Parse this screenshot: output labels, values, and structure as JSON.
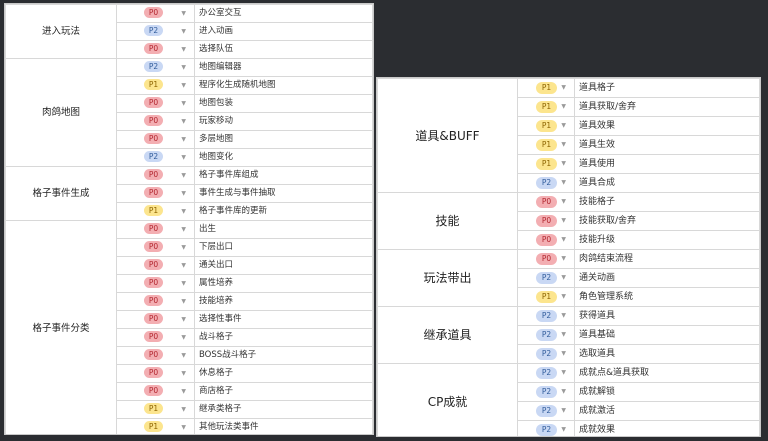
{
  "left_table": {
    "groups": [
      {
        "category": "进入玩法",
        "rows": [
          {
            "priority": "P0",
            "task": "办公室交互"
          },
          {
            "priority": "P2",
            "task": "进入动画"
          },
          {
            "priority": "P0",
            "task": "选择队伍"
          }
        ]
      },
      {
        "category": "肉鸽地图",
        "rows": [
          {
            "priority": "P2",
            "task": "地图编辑器"
          },
          {
            "priority": "P1",
            "task": "程序化生成随机地图"
          },
          {
            "priority": "P0",
            "task": "地图包装"
          },
          {
            "priority": "P0",
            "task": "玩家移动"
          },
          {
            "priority": "P0",
            "task": "多层地图"
          },
          {
            "priority": "P2",
            "task": "地图变化"
          }
        ]
      },
      {
        "category": "格子事件生成",
        "rows": [
          {
            "priority": "P0",
            "task": "格子事件库组成"
          },
          {
            "priority": "P0",
            "task": "事件生成与事件抽取"
          },
          {
            "priority": "P1",
            "task": "格子事件库的更新"
          }
        ]
      },
      {
        "category": "格子事件分类",
        "rows": [
          {
            "priority": "P0",
            "task": "出生"
          },
          {
            "priority": "P0",
            "task": "下层出口"
          },
          {
            "priority": "P0",
            "task": "通关出口"
          },
          {
            "priority": "P0",
            "task": "属性培养"
          },
          {
            "priority": "P0",
            "task": "技能培养"
          },
          {
            "priority": "P0",
            "task": "选择性事件"
          },
          {
            "priority": "P0",
            "task": "战斗格子"
          },
          {
            "priority": "P0",
            "task": "BOSS战斗格子"
          },
          {
            "priority": "P0",
            "task": "休息格子"
          },
          {
            "priority": "P0",
            "task": "商店格子"
          },
          {
            "priority": "P1",
            "task": "继承类格子"
          },
          {
            "priority": "P1",
            "task": "其他玩法类事件"
          }
        ]
      }
    ]
  },
  "right_table": {
    "groups": [
      {
        "category": "道具&BUFF",
        "rows": [
          {
            "priority": "P1",
            "task": "道具格子"
          },
          {
            "priority": "P1",
            "task": "道具获取/舍弃"
          },
          {
            "priority": "P1",
            "task": "道具效果"
          },
          {
            "priority": "P1",
            "task": "道具生效"
          },
          {
            "priority": "P1",
            "task": "道具使用"
          },
          {
            "priority": "P2",
            "task": "道具合成"
          }
        ]
      },
      {
        "category": "技能",
        "rows": [
          {
            "priority": "P0",
            "task": "技能格子"
          },
          {
            "priority": "P0",
            "task": "技能获取/舍弃"
          },
          {
            "priority": "P0",
            "task": "技能升级"
          }
        ]
      },
      {
        "category": "玩法带出",
        "rows": [
          {
            "priority": "P0",
            "task": "肉鸽结束流程"
          },
          {
            "priority": "P2",
            "task": "通关动画"
          },
          {
            "priority": "P1",
            "task": "角色管理系统"
          }
        ]
      },
      {
        "category": "继承道具",
        "rows": [
          {
            "priority": "P2",
            "task": "获得道具"
          },
          {
            "priority": "P2",
            "task": "道具基础"
          },
          {
            "priority": "P2",
            "task": "选取道具"
          }
        ]
      },
      {
        "category": "CP成就",
        "rows": [
          {
            "priority": "P2",
            "task": "成就点&道具获取"
          },
          {
            "priority": "P2",
            "task": "成就解锁"
          },
          {
            "priority": "P2",
            "task": "成就激活"
          },
          {
            "priority": "P2",
            "task": "成就效果"
          }
        ]
      }
    ]
  },
  "dropdown_caret_glyph": "▼",
  "priority_colors": {
    "P0": {
      "bg": "#f3aeb2",
      "text": "#b2262f"
    },
    "P1": {
      "bg": "#fce58e",
      "text": "#8d6400"
    },
    "P2": {
      "bg": "#c9d8f4",
      "text": "#325d9c"
    }
  }
}
